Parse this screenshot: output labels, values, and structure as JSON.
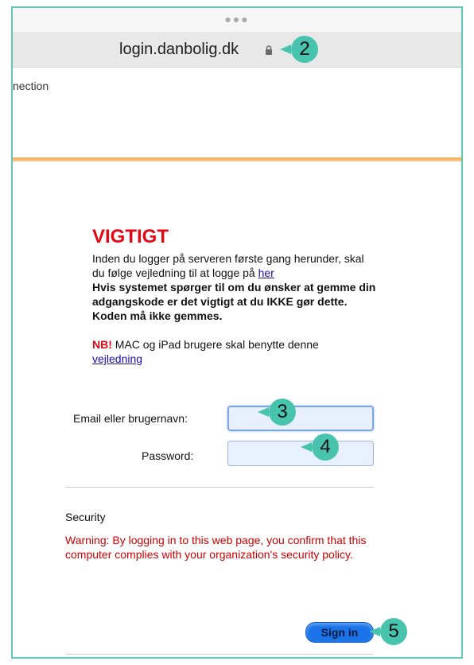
{
  "browser": {
    "url": "login.danbolig.dk",
    "partial_text": "nection",
    "icons": {
      "lock": "lock-icon",
      "dots": "more-dots-icon"
    }
  },
  "callouts": [
    "2",
    "3",
    "4",
    "5"
  ],
  "notice": {
    "heading": "VIGTIGT",
    "line1_text": "Inden du logger på serveren første gang herunder, skal du følge vejledning til at logge på ",
    "line1_link": "her",
    "bold_text": "Hvis systemet spørger til om du ønsker at gemme din adgangskode er det vigtigt at du IKKE gør dette. Koden må ikke gemmes.",
    "nb_label": "NB!",
    "nb_text": " MAC og iPad brugere skal benytte denne ",
    "nb_link": "vejledning"
  },
  "form": {
    "username_label": "Email eller brugernavn:",
    "username_value": "",
    "password_label": "Password:",
    "password_value": ""
  },
  "security": {
    "title": "Security",
    "warning": "Warning: By logging in to this web page, you confirm that this computer complies with your organization's security policy."
  },
  "actions": {
    "signin_label": "Sign in"
  },
  "colors": {
    "accent": "#48c3ae",
    "heading": "#e30613",
    "warning": "#cc0000",
    "button": "#1a73e8"
  }
}
